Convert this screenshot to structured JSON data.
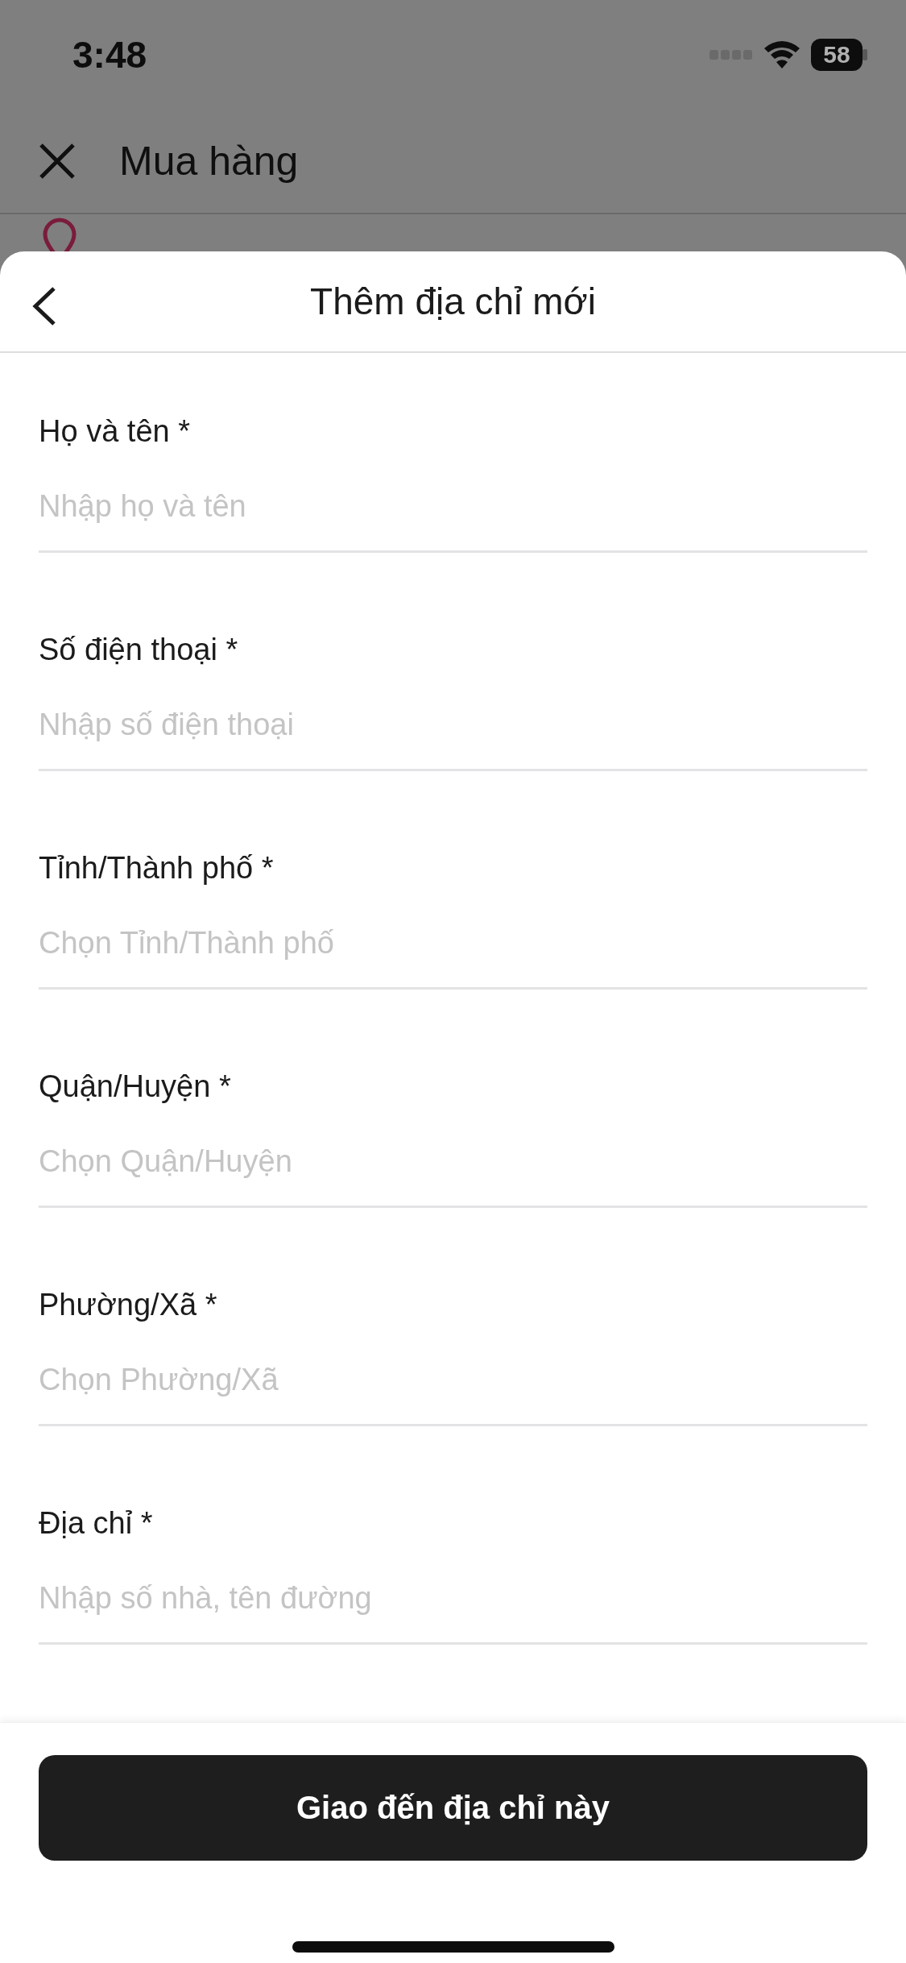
{
  "status_bar": {
    "time": "3:48",
    "battery": "58"
  },
  "background_header": {
    "title": "Mua hàng"
  },
  "sheet": {
    "title": "Thêm địa chỉ mới"
  },
  "fields": [
    {
      "label": "Họ và tên *",
      "placeholder": "Nhập họ và tên"
    },
    {
      "label": "Số điện thoại *",
      "placeholder": "Nhập số điện thoại"
    },
    {
      "label": "Tỉnh/Thành phố *",
      "placeholder": "Chọn Tỉnh/Thành phố"
    },
    {
      "label": "Quận/Huyện *",
      "placeholder": "Chọn Quận/Huyện"
    },
    {
      "label": "Phường/Xã *",
      "placeholder": "Chọn Phường/Xã"
    },
    {
      "label": "Địa chỉ *",
      "placeholder": "Nhập số nhà, tên đường"
    }
  ],
  "submit_button": "Giao đến địa chỉ này"
}
